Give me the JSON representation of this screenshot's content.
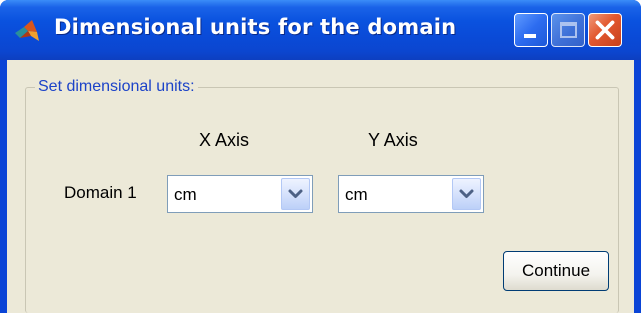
{
  "window": {
    "title": "Dimensional units for the domain",
    "icon": "matlab-icon",
    "caption_buttons": [
      "minimize-icon",
      "maximize-icon",
      "close-icon"
    ],
    "colors": {
      "titlebar": "#0a52df",
      "client": "#ece9d8",
      "group_label": "#1c43c8",
      "close_button": "#e2582f"
    }
  },
  "group": {
    "label": "Set dimensional units:"
  },
  "headers": {
    "x_axis": "X Axis",
    "y_axis": "Y Axis"
  },
  "rows": [
    {
      "label": "Domain 1",
      "x_unit": "cm",
      "y_unit": "cm"
    }
  ],
  "buttons": {
    "continue": "Continue"
  }
}
